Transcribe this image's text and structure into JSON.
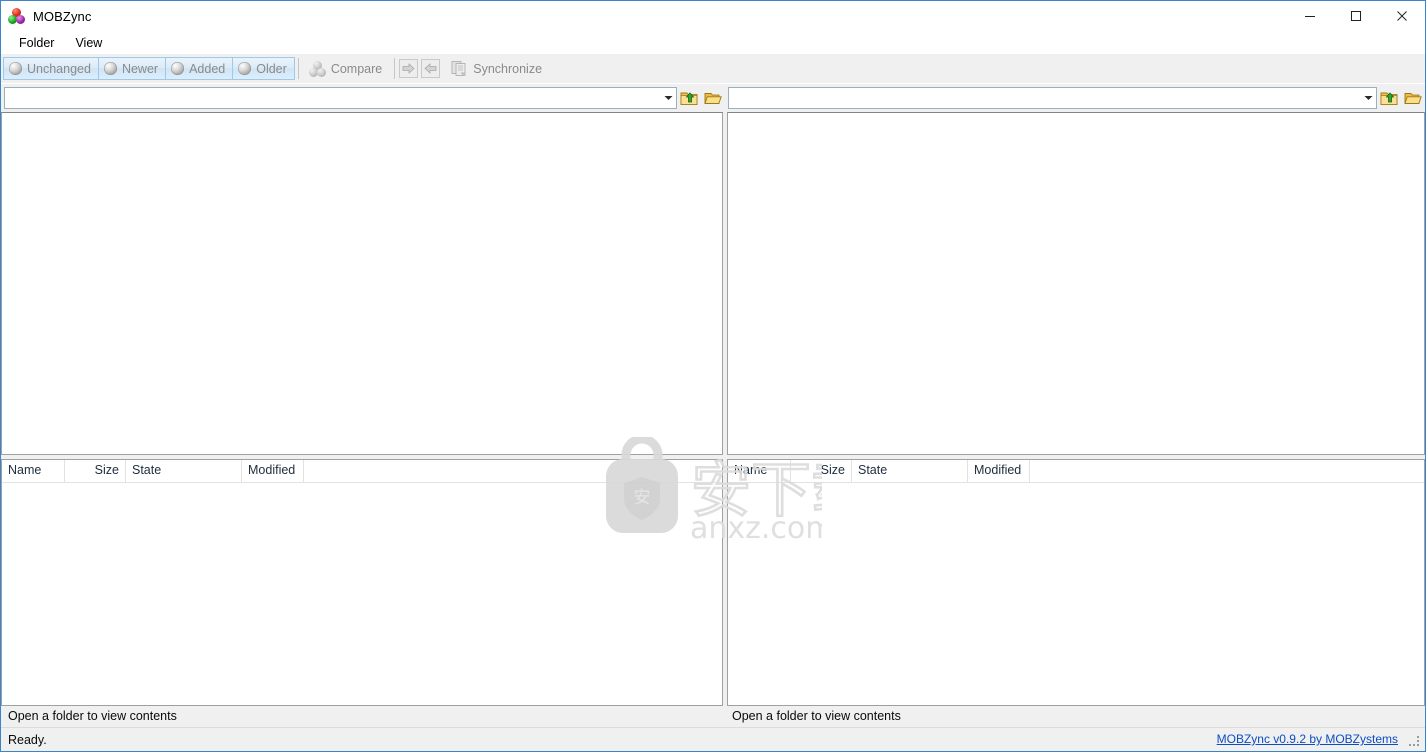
{
  "window": {
    "title": "MOBZync",
    "app_icon": "mobzync-logo-icon",
    "minimize_label": "─",
    "maximize_label": "□",
    "close_label": "✕"
  },
  "menubar": {
    "items": [
      {
        "label": "Folder"
      },
      {
        "label": "View"
      }
    ]
  },
  "toolbar": {
    "filters": [
      {
        "label": "Unchanged",
        "icon": "gray-sphere-icon",
        "pressed": true
      },
      {
        "label": "Newer",
        "icon": "gray-sphere-icon",
        "pressed": true
      },
      {
        "label": "Added",
        "icon": "gray-sphere-icon",
        "pressed": true
      },
      {
        "label": "Older",
        "icon": "gray-sphere-icon",
        "pressed": true
      }
    ],
    "compare": {
      "label": "Compare",
      "icon": "compare-balls-icon"
    },
    "copy_right": {
      "icon": "arrow-right-icon",
      "label": ""
    },
    "copy_left": {
      "icon": "arrow-left-icon",
      "label": ""
    },
    "synchronize": {
      "label": "Synchronize",
      "icon": "synchronize-icon"
    }
  },
  "panes": {
    "left": {
      "path": {
        "value": "",
        "placeholder": ""
      },
      "up_button": {
        "icon": "folder-up-icon"
      },
      "browse_button": {
        "icon": "folder-open-icon"
      },
      "columns": [
        {
          "label": "Name"
        },
        {
          "label": "Size"
        },
        {
          "label": "State"
        },
        {
          "label": "Modified"
        }
      ],
      "status": "Open a folder to view contents"
    },
    "right": {
      "path": {
        "value": "",
        "placeholder": ""
      },
      "up_button": {
        "icon": "folder-up-icon"
      },
      "browse_button": {
        "icon": "folder-open-icon"
      },
      "columns": [
        {
          "label": "Name"
        },
        {
          "label": "Size"
        },
        {
          "label": "State"
        },
        {
          "label": "Modified"
        }
      ],
      "status": "Open a folder to view contents"
    }
  },
  "watermark": {
    "text_cn": "安下载",
    "badge_char": "安",
    "domain": "anxz.com"
  },
  "statusbar": {
    "message": "Ready.",
    "link": "MOBZync v0.9.2 by MOBZystems",
    "grip": "resize-grip-icon"
  },
  "colors": {
    "window_border": "#3a85c8",
    "toolbar_bg": "#f0f0f0",
    "toggle_border": "#9fc9e8",
    "link": "#0b4ec4",
    "pane_border": "#a0a0a0"
  }
}
